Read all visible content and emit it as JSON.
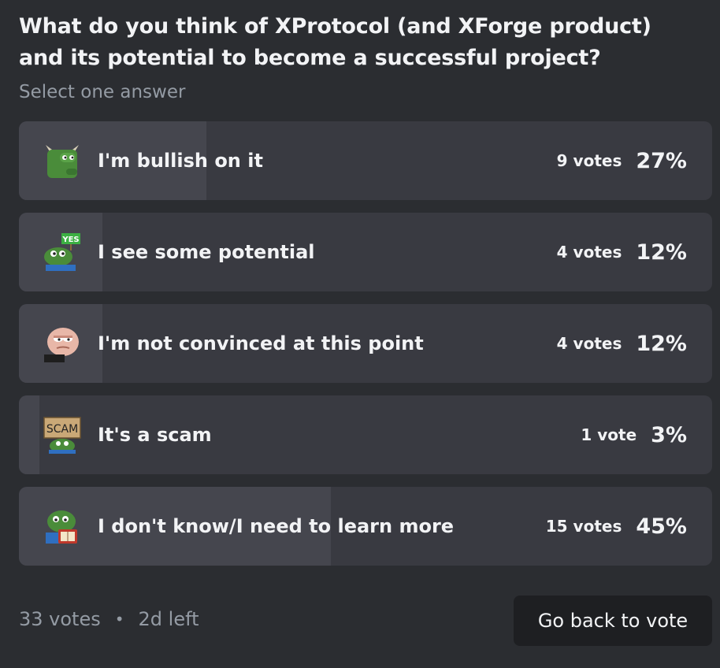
{
  "poll": {
    "question": "What do you think of XProtocol (and XForge product) and its potential to become a successful project?",
    "hint": "Select one answer",
    "answers": [
      {
        "label": "I'm bullish on it",
        "votes": "9 votes",
        "percent": "27%",
        "fraction": 0.27,
        "emoji": "bull-pepe-emoji"
      },
      {
        "label": "I see some potential",
        "votes": "4 votes",
        "percent": "12%",
        "fraction": 0.12,
        "emoji": "pepe-yes-sign-emoji",
        "emoji_text": "YES"
      },
      {
        "label": "I'm not convinced at this point",
        "votes": "4 votes",
        "percent": "12%",
        "fraction": 0.12,
        "emoji": "skeptical-pepe-emoji"
      },
      {
        "label": "It's a scam",
        "votes": "1 vote",
        "percent": "3%",
        "fraction": 0.03,
        "emoji": "pepe-scam-sign-emoji",
        "emoji_text": "SCAM"
      },
      {
        "label": "I don't know/I need to learn more",
        "votes": "15 votes",
        "percent": "45%",
        "fraction": 0.45,
        "emoji": "pepe-reading-emoji"
      }
    ],
    "total_votes": "33 votes",
    "separator": "•",
    "time_left": "2d left",
    "back_button_label": "Go back to vote"
  },
  "colors": {
    "background": "#2b2d31",
    "answer_bg": "#393a41",
    "answer_fill": "#45464e",
    "muted_text": "#949ba4",
    "button_bg": "#1e1f22",
    "pepe_green": "#4a8c3a"
  }
}
